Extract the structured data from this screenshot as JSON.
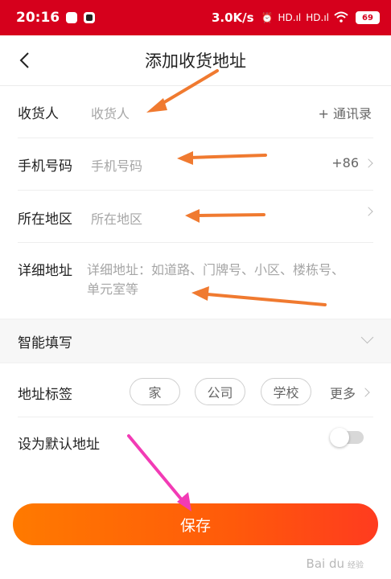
{
  "status_bar": {
    "time": "20:16",
    "speed": "3.0K/s",
    "signal1": "HD.ıl",
    "signal2": "HD.ıl",
    "battery": "69"
  },
  "header": {
    "title": "添加收货地址",
    "back_icon": "chevron-left-icon"
  },
  "form": {
    "recipient": {
      "label": "收货人",
      "placeholder": "收货人",
      "action": "+ 通讯录"
    },
    "phone": {
      "label": "手机号码",
      "placeholder": "手机号码",
      "prefix": "+86"
    },
    "region": {
      "label": "所在地区",
      "placeholder": "所在地区"
    },
    "detail": {
      "label": "详细地址",
      "placeholder_line1": "详细地址：如道路、门牌号、小区、楼栋号、",
      "placeholder_line2": "单元室等"
    }
  },
  "smart_fill": {
    "label": "智能填写"
  },
  "address_tag": {
    "label": "地址标签",
    "tags": [
      "家",
      "公司",
      "学校"
    ],
    "more": "更多"
  },
  "default_address": {
    "label": "设为默认地址",
    "enabled": false
  },
  "save_button": {
    "label": "保存"
  },
  "colors": {
    "status_bar": "#d6001c",
    "accent": "#ff6a00",
    "annotation_arrow": "#f07a30",
    "annotation_arrow_pink": "#f23bb5"
  },
  "watermark": {
    "text": "Bai du",
    "sub": "经验"
  }
}
